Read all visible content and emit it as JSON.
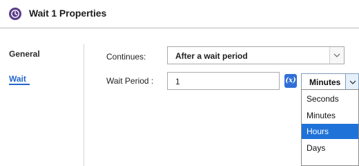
{
  "header": {
    "title": "Wait 1 Properties",
    "icon": "clock-icon",
    "icon_color": "#5a3d8a"
  },
  "nav": {
    "items": [
      {
        "label": "General",
        "active": false
      },
      {
        "label": "Wait",
        "active": true
      }
    ],
    "active_color": "#2266cc"
  },
  "form": {
    "continues": {
      "label": "Continues:",
      "value": "After a wait period"
    },
    "wait_period": {
      "label": "Wait Period :",
      "value": "1",
      "variable_button": "(x)",
      "unit": {
        "value": "Minutes",
        "options": [
          {
            "label": "Seconds",
            "highlighted": false
          },
          {
            "label": "Minutes",
            "highlighted": false
          },
          {
            "label": "Hours",
            "highlighted": true
          },
          {
            "label": "Days",
            "highlighted": false
          }
        ],
        "highlight_color": "#1f72d8"
      }
    }
  }
}
